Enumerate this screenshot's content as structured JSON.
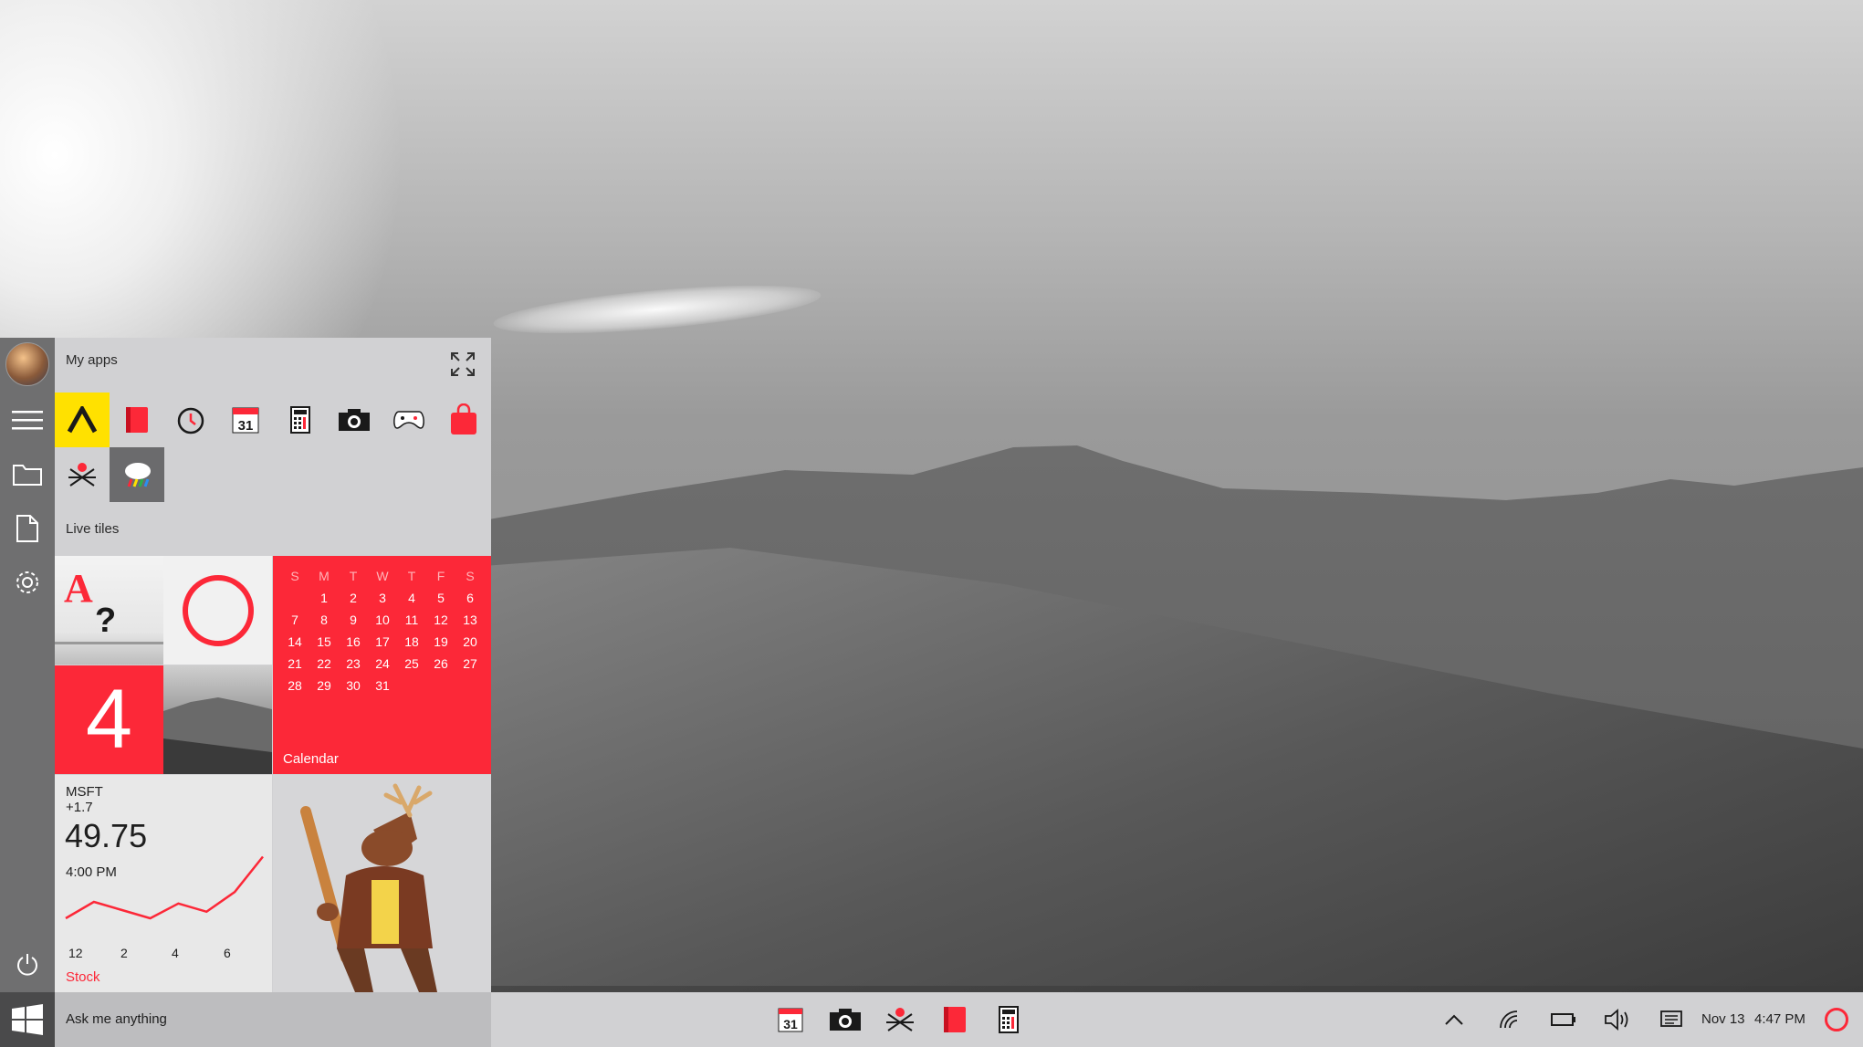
{
  "start_menu": {
    "my_apps_label": "My apps",
    "live_tiles_label": "Live tiles",
    "apps_row1": [
      "app-a-icon",
      "notebook-icon",
      "alarm-clock-icon",
      "calendar-icon",
      "calculator-icon",
      "camera-icon",
      "gamepad-icon",
      "store-bag-icon"
    ],
    "apps_row2": [
      "maps-icon",
      "weather-icon"
    ],
    "rail": [
      "avatar",
      "hamburger-menu-icon",
      "folder-icon",
      "document-icon",
      "settings-icon",
      "power-icon"
    ]
  },
  "tiles": {
    "count_tile": {
      "value": "4"
    },
    "calendar": {
      "label": "Calendar",
      "weekdays": [
        "S",
        "M",
        "T",
        "W",
        "T",
        "F",
        "S"
      ],
      "days": [
        "",
        "1",
        "2",
        "3",
        "4",
        "5",
        "6",
        "7",
        "8",
        "9",
        "10",
        "11",
        "12",
        "13",
        "14",
        "15",
        "16",
        "17",
        "18",
        "19",
        "20",
        "21",
        "22",
        "23",
        "24",
        "25",
        "26",
        "27",
        "28",
        "29",
        "30",
        "31"
      ]
    },
    "stock": {
      "symbol": "MSFT",
      "change": "+1.7",
      "price": "49.75",
      "time": "4:00 PM",
      "label": "Stock",
      "x_ticks": [
        "12",
        "2",
        "4",
        "6"
      ]
    }
  },
  "chart_data": {
    "type": "line",
    "x": [
      0,
      1,
      2,
      3,
      4,
      5,
      6,
      7
    ],
    "values": [
      2,
      4,
      3,
      2,
      3.8,
      2.8,
      5.2,
      9.5
    ],
    "x_tick_labels": [
      "12",
      "2",
      "4",
      "6"
    ],
    "color": "#fc2838"
  },
  "search": {
    "placeholder": "Ask me anything"
  },
  "taskbar": {
    "pinned": [
      "calendar-icon",
      "camera-icon",
      "maps-icon",
      "notebook-icon",
      "calculator-icon"
    ],
    "date": "Nov 13",
    "time": "4:47 PM"
  },
  "colors": {
    "accent": "#fc2838",
    "yellow": "#ffe100"
  },
  "calendar_icon_day": "31"
}
